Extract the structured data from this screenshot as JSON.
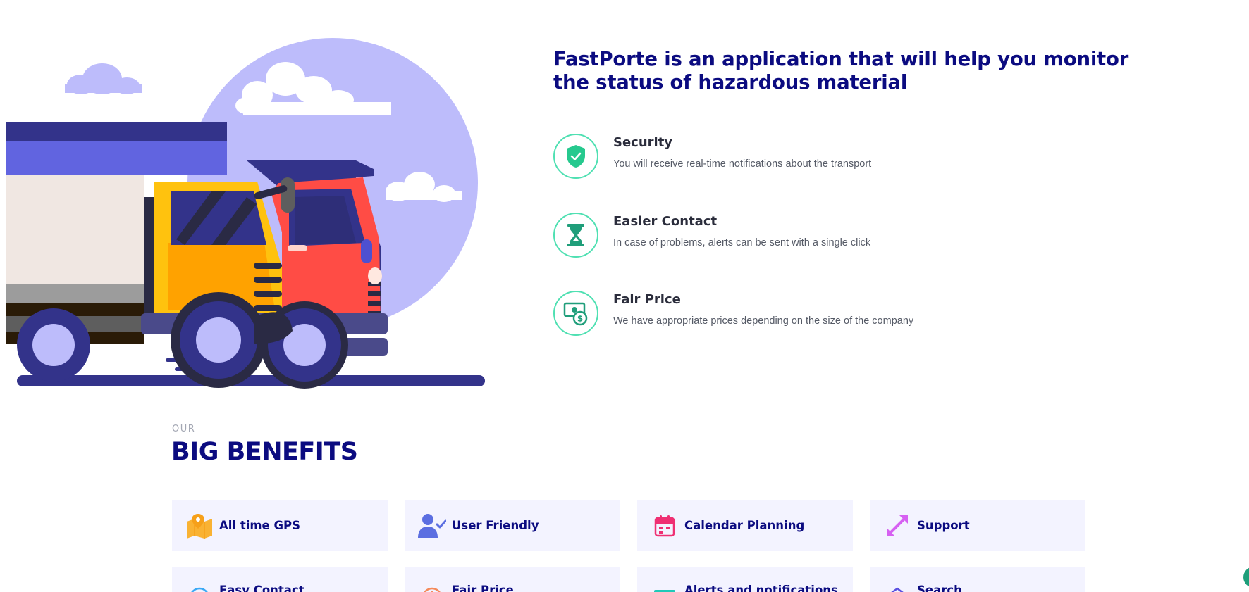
{
  "hero": {
    "title": "FastPorte is an application that will help you monitor the status of hazardous material"
  },
  "features": [
    {
      "title": "Security",
      "description": "You will receive real-time notifications about the transport",
      "icon": "shield-check-icon"
    },
    {
      "title": "Easier Contact",
      "description": "In case of problems, alerts can be sent with a single click",
      "icon": "hourglass-icon"
    },
    {
      "title": "Fair Price",
      "description": "We have appropriate prices depending on the size of the company",
      "icon": "money-icon"
    }
  ],
  "benefits": {
    "eyebrow": "OUR",
    "title": "BIG BENEFITS",
    "items": [
      {
        "label": "All time GPS",
        "icon": "map-pin-icon",
        "color": "#f9b233"
      },
      {
        "label": "User Friendly",
        "icon": "user-check-icon",
        "color": "#5b6ee1"
      },
      {
        "label": "Calendar Planning",
        "icon": "calendar-icon",
        "color": "#ef2f73"
      },
      {
        "label": "Support",
        "icon": "expand-arrows-icon",
        "color": "#d660f2"
      },
      {
        "label": "Easy Contact",
        "icon": "chat-icon",
        "color": "#3ba9f5"
      },
      {
        "label": "Fair Price",
        "icon": "clock-icon",
        "color": "#f58a5b"
      },
      {
        "label": "Alerts and notifications",
        "icon": "alert-card-icon",
        "color": "#1fc9b8"
      },
      {
        "label": "Search",
        "icon": "house-search-icon",
        "color": "#5a4fe0"
      }
    ]
  },
  "colors": {
    "heading": "#0b0b80",
    "accent": "#4fe0b2",
    "card_background": "#f3f3ff",
    "illustration_circle": "#bdbcfb"
  }
}
